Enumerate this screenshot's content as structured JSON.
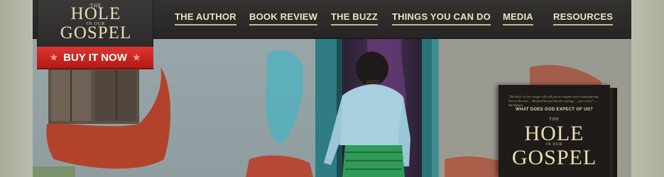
{
  "logo": {
    "the": "THE",
    "hole": "HOLE",
    "in_our": "IN OUR",
    "gospel": "GOSPEL"
  },
  "buy_button": {
    "label": "BUY IT NOW",
    "star_left": "★",
    "star_right": "★"
  },
  "nav": {
    "items": [
      {
        "label": "THE AUTHOR"
      },
      {
        "label": "BOOK REVIEW"
      },
      {
        "label": "THE BUZZ"
      },
      {
        "label": "THINGS YOU CAN DO"
      },
      {
        "label": "MEDIA"
      },
      {
        "label": "RESOURCES"
      }
    ]
  },
  "book": {
    "quote": "\"The Hole in Our Gospel will call you to a higher level of discipleship. Now is the time ... Richard Stearns has the courage ... your move!\" —Bill Hybels",
    "tagline": "WHAT DOES GOD EXPECT OF US?",
    "the": "THE",
    "hole": "HOLE",
    "in_our": "IN OUR",
    "gospel": "GOSPEL"
  },
  "colors": {
    "nav_text": "#efe2bd",
    "nav_underline": "#c7b88c",
    "buy_red": "#d3271f",
    "bar_dark": "#2c2b2a",
    "page_bg": "#b3b4a3"
  },
  "icons": {
    "star": "star-icon"
  }
}
